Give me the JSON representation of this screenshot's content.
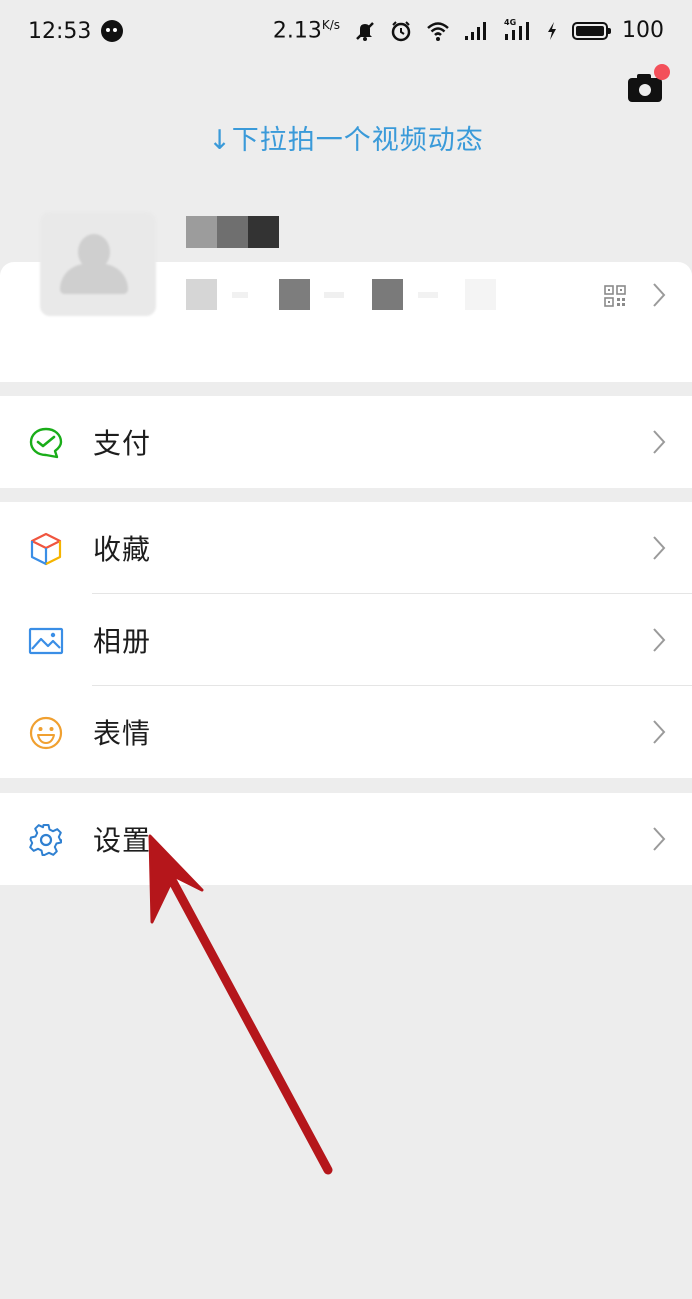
{
  "status_bar": {
    "time": "12:53",
    "speed": "2.13",
    "speed_unit": "K/s",
    "network_label": "4G",
    "battery": "100"
  },
  "header": {
    "pull_hint": "↓下拉拍一个视频动态",
    "camera_icon": "camera-icon",
    "camera_badge_color": "#f3505a"
  },
  "profile": {
    "name": "",
    "id": ""
  },
  "menu": {
    "pay": {
      "label": "支付",
      "icon": "wechat-pay-icon",
      "color": "#1aad19"
    },
    "favorites": {
      "label": "收藏",
      "icon": "favorites-cube-icon"
    },
    "album": {
      "label": "相册",
      "icon": "album-image-icon",
      "color": "#3a8ee6"
    },
    "stickers": {
      "label": "表情",
      "icon": "smiley-icon",
      "color": "#f0a030"
    },
    "settings": {
      "label": "设置",
      "icon": "gear-icon",
      "color": "#2f80d1"
    }
  },
  "annotation": {
    "arrow_color": "#b5161b"
  }
}
